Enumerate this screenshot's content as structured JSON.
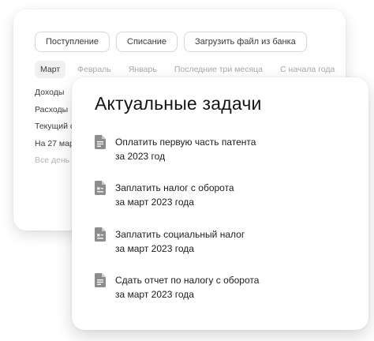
{
  "back_card": {
    "actions": [
      "Поступление",
      "Списание",
      "Загрузить файл из банка"
    ],
    "periods": [
      "Март",
      "Февраль",
      "Январь",
      "Последние три месяца",
      "С начала года"
    ],
    "active_period": "Март",
    "summary": [
      {
        "label": "Доходы",
        "muted": false
      },
      {
        "label": "Расходы",
        "muted": false
      },
      {
        "label": "Текущий с",
        "muted": false
      },
      {
        "label": "На 27 мар",
        "muted": false
      },
      {
        "label": "Все день",
        "muted": true
      }
    ]
  },
  "front_card": {
    "title": "Актуальные задачи",
    "tasks": [
      {
        "title": "Оплатить первую часть патента",
        "subtitle": "за 2023 год",
        "icon": "document-icon"
      },
      {
        "title": "Заплатить налог с оборота",
        "subtitle": "за март 2023 года",
        "icon": "tax-document-icon"
      },
      {
        "title": "Заплатить социальный налог",
        "subtitle": "за март 2023 года",
        "icon": "tax-document-icon"
      },
      {
        "title": "Сдать отчет по налогу с оборота",
        "subtitle": "за март 2023 года",
        "icon": "document-icon"
      }
    ]
  },
  "colors": {
    "icon": "#8d8d8d",
    "muted_text": "#a8a8a8",
    "active_tab_bg": "#f0f0f0"
  }
}
